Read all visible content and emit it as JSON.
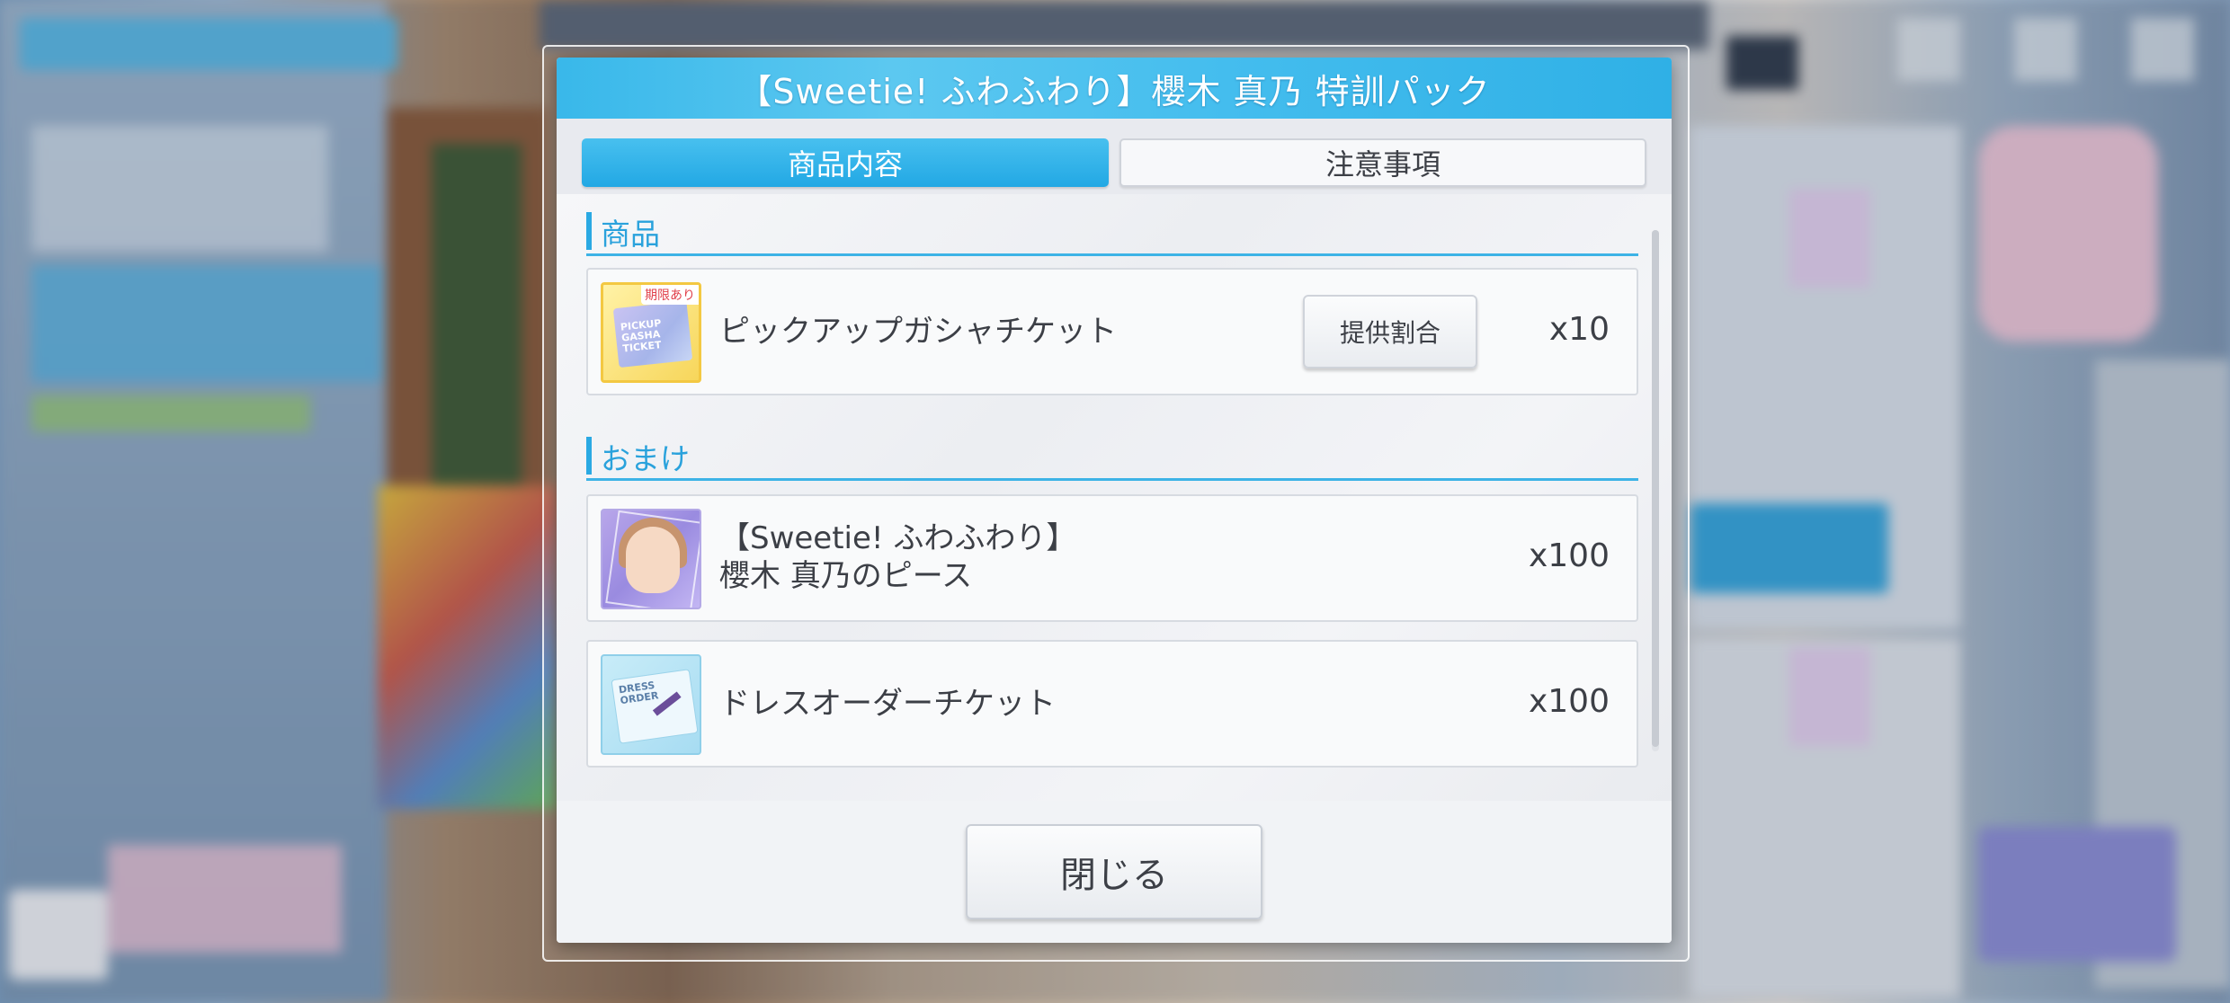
{
  "dialog": {
    "title": "【Sweetie! ふわふわり】櫻木 真乃 特訓パック",
    "tabs": [
      {
        "label": "商品内容",
        "active": true
      },
      {
        "label": "注意事項",
        "active": false
      }
    ],
    "sections": {
      "products": {
        "heading": "商品",
        "items": [
          {
            "name": "ピックアップガシャチケット",
            "quantity": "x10",
            "icon": "gacha-ticket-icon",
            "badge": "期限あり",
            "icon_text": "PICKUP GASHA TICKET",
            "button": "提供割合"
          }
        ]
      },
      "bonus": {
        "heading": "おまけ",
        "items": [
          {
            "name_line1": "【Sweetie! ふわふわり】",
            "name_line2": "櫻木 真乃のピース",
            "quantity": "x100",
            "icon": "character-piece-icon"
          },
          {
            "name": "ドレスオーダーチケット",
            "quantity": "x100",
            "icon": "dress-order-ticket-icon",
            "icon_text": "DRESS ORDER"
          }
        ]
      }
    },
    "close_label": "閉じる"
  },
  "colors": {
    "accent": "#2aa9e3",
    "header": "#44bdee",
    "text": "#3c3f46"
  }
}
